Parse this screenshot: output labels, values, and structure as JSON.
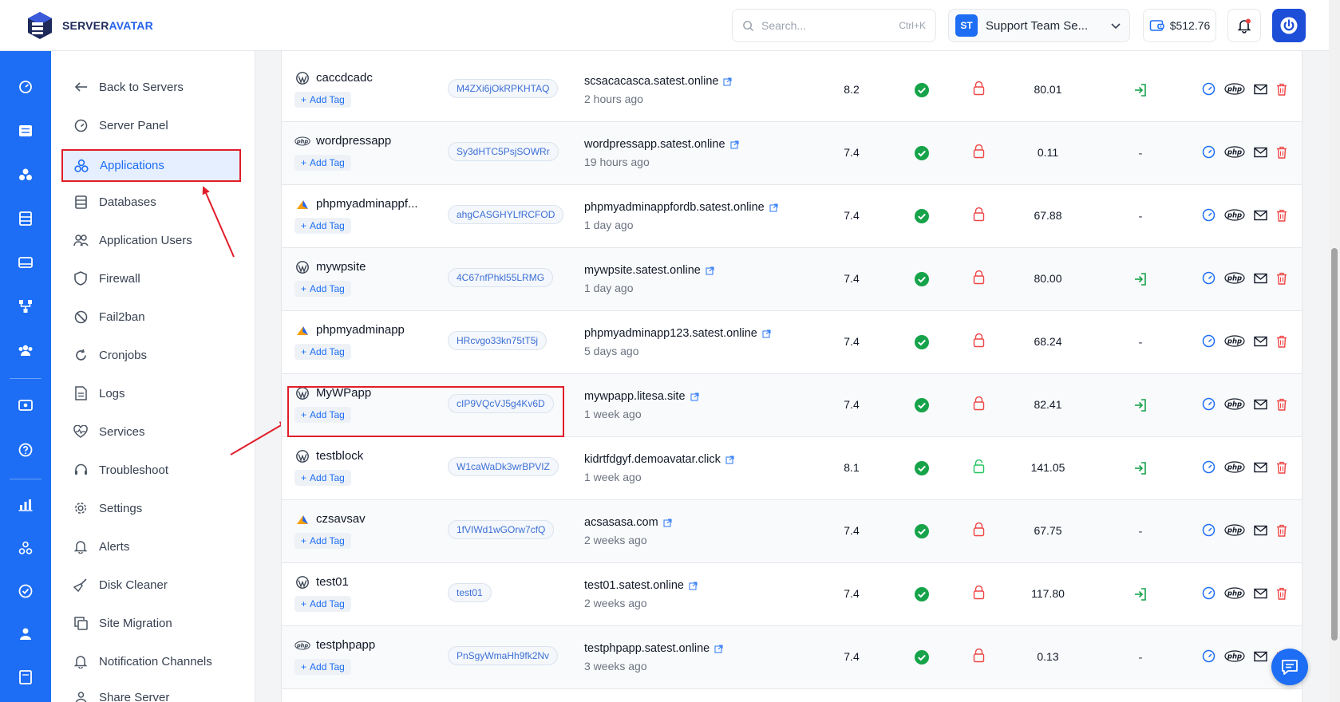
{
  "brand": {
    "name_part1": "SERVER",
    "name_part2": "AVATAR"
  },
  "header": {
    "search_placeholder": "Search...",
    "search_shortcut": "Ctrl+K",
    "team_initials": "ST",
    "team_name": "Support Team Se...",
    "balance": "$512.76"
  },
  "colors": {
    "primary": "#1d6ef5",
    "highlight": "#e11d2a",
    "success": "#16a34a",
    "danger": "#ef4444"
  },
  "sidebar": {
    "items": [
      {
        "label": "Back to Servers",
        "icon": "arrow-left-icon"
      },
      {
        "label": "Server Panel",
        "icon": "gauge-icon"
      },
      {
        "label": "Applications",
        "icon": "applications-icon",
        "active": true
      },
      {
        "label": "Databases",
        "icon": "database-icon"
      },
      {
        "label": "Application Users",
        "icon": "users-icon"
      },
      {
        "label": "Firewall",
        "icon": "shield-icon"
      },
      {
        "label": "Fail2ban",
        "icon": "ban-icon"
      },
      {
        "label": "Cronjobs",
        "icon": "refresh-icon"
      },
      {
        "label": "Logs",
        "icon": "file-icon"
      },
      {
        "label": "Services",
        "icon": "heart-pulse-icon"
      },
      {
        "label": "Troubleshoot",
        "icon": "headset-icon"
      },
      {
        "label": "Settings",
        "icon": "gear-icon"
      },
      {
        "label": "Alerts",
        "icon": "bell-icon"
      },
      {
        "label": "Disk Cleaner",
        "icon": "broom-icon"
      },
      {
        "label": "Site Migration",
        "icon": "copy-icon"
      },
      {
        "label": "Notification Channels",
        "icon": "bell-icon"
      },
      {
        "label": "Share Server",
        "icon": "share-icon"
      }
    ]
  },
  "add_tag_label": "Add Tag",
  "applications": [
    {
      "name": "caccdcadc",
      "type": "wordpress",
      "system_user": "M4ZXi6jOkRPKHTAQ",
      "domain": "scsacacasca.satest.online",
      "age": "2 hours ago",
      "php": "8.2",
      "ssl_ok": true,
      "locked": true,
      "size": "80.01",
      "login": "icon"
    },
    {
      "name": "wordpressapp",
      "type": "php",
      "system_user": "Sy3dHTC5PsjSOWRr",
      "domain": "wordpressapp.satest.online",
      "age": "19 hours ago",
      "php": "7.4",
      "ssl_ok": true,
      "locked": true,
      "size": "0.11",
      "login": "-"
    },
    {
      "name": "phpmyadminappf...",
      "type": "phpmyadmin",
      "system_user": "ahgCASGHYLfRCFOD",
      "domain": "phpmyadminappfordb.satest.online",
      "age": "1 day ago",
      "php": "7.4",
      "ssl_ok": true,
      "locked": true,
      "size": "67.88",
      "login": "-"
    },
    {
      "name": "mywpsite",
      "type": "wordpress",
      "system_user": "4C67nfPhkl55LRMG",
      "domain": "mywpsite.satest.online",
      "age": "1 day ago",
      "php": "7.4",
      "ssl_ok": true,
      "locked": true,
      "size": "80.00",
      "login": "icon"
    },
    {
      "name": "phpmyadminapp",
      "type": "phpmyadmin",
      "system_user": "HRcvgo33kn75tT5j",
      "domain": "phpmyadminapp123.satest.online",
      "age": "5 days ago",
      "php": "7.4",
      "ssl_ok": true,
      "locked": true,
      "size": "68.24",
      "login": "-"
    },
    {
      "name": "MyWPapp",
      "type": "wordpress",
      "system_user": "cIP9VQcVJ5g4Kv6D",
      "domain": "mywpapp.litesa.site",
      "age": "1 week ago",
      "php": "7.4",
      "ssl_ok": true,
      "locked": true,
      "size": "82.41",
      "login": "icon",
      "highlight": true
    },
    {
      "name": "testblock",
      "type": "wordpress",
      "system_user": "W1caWaDk3wrBPVIZ",
      "domain": "kidrtfdgyf.demoavatar.click",
      "age": "1 week ago",
      "php": "8.1",
      "ssl_ok": true,
      "locked": false,
      "size": "141.05",
      "login": "icon"
    },
    {
      "name": "czsavsav",
      "type": "phpmyadmin",
      "system_user": "1fVIWd1wGOrw7cfQ",
      "domain": "acsasasa.com",
      "age": "2 weeks ago",
      "php": "7.4",
      "ssl_ok": true,
      "locked": true,
      "size": "67.75",
      "login": "-"
    },
    {
      "name": "test01",
      "type": "wordpress",
      "system_user": "test01",
      "domain": "test01.satest.online",
      "age": "2 weeks ago",
      "php": "7.4",
      "ssl_ok": true,
      "locked": true,
      "size": "117.80",
      "login": "icon"
    },
    {
      "name": "testphpapp",
      "type": "php",
      "system_user": "PnSgyWmaHh9fk2Nv",
      "domain": "testphpapp.satest.online",
      "age": "3 weeks ago",
      "php": "7.4",
      "ssl_ok": true,
      "locked": true,
      "size": "0.13",
      "login": "-"
    }
  ]
}
